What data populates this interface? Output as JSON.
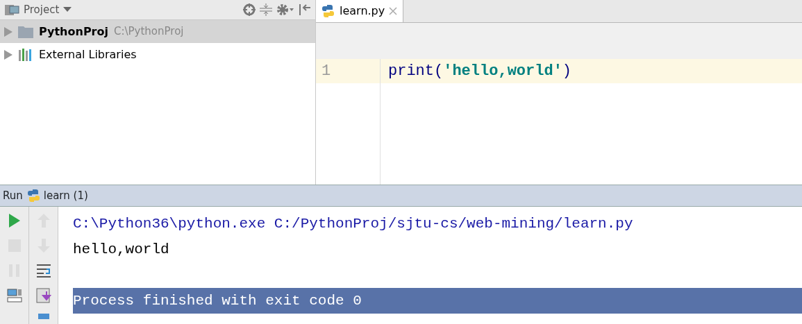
{
  "project_panel": {
    "title": "Project",
    "tree": [
      {
        "kind": "folder",
        "name": "PythonProj",
        "path": "C:\\PythonProj",
        "selected": true
      },
      {
        "kind": "library",
        "name": "External Libraries",
        "selected": false
      }
    ]
  },
  "editor": {
    "tabs": [
      {
        "label": "learn.py",
        "selected": true
      }
    ],
    "lines": [
      {
        "number": "1",
        "current": true,
        "tokens": [
          {
            "kind": "keyword",
            "text": "print("
          },
          {
            "kind": "string",
            "text": "'hello,world'"
          },
          {
            "kind": "keyword",
            "text": ")"
          }
        ]
      }
    ]
  },
  "run_panel": {
    "title": "Run",
    "tab": "learn (1)",
    "toolbar_left": [
      {
        "kind": "run",
        "disabled": false
      },
      {
        "kind": "stop",
        "disabled": true
      },
      {
        "kind": "pause",
        "disabled": true
      },
      {
        "kind": "layout",
        "disabled": false
      }
    ],
    "toolbar_right": [
      {
        "kind": "up",
        "disabled": true
      },
      {
        "kind": "down",
        "disabled": true
      },
      {
        "kind": "wrap",
        "disabled": false
      },
      {
        "kind": "scroll-end",
        "disabled": false
      },
      {
        "kind": "print",
        "disabled": false
      }
    ],
    "output": [
      {
        "kind": "command",
        "text": "C:\\Python36\\python.exe C:/PythonProj/sjtu-cs/web-mining/learn.py",
        "selected": false
      },
      {
        "kind": "stdout",
        "text": "hello,world",
        "selected": false
      },
      {
        "kind": "blank",
        "selected": false
      },
      {
        "kind": "system",
        "text": "Process finished with exit code 0",
        "selected": true
      }
    ]
  }
}
